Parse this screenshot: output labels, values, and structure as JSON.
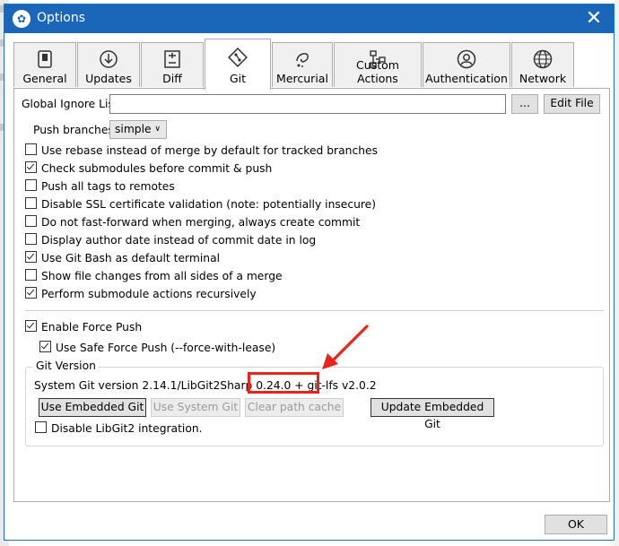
{
  "window": {
    "title": "Options",
    "close_symbol": "✕"
  },
  "tabs": [
    {
      "label": "General",
      "icon": "general-icon",
      "active": false
    },
    {
      "label": "Updates",
      "icon": "updates-icon",
      "active": false
    },
    {
      "label": "Diff",
      "icon": "diff-icon",
      "active": false
    },
    {
      "label": "Git",
      "icon": "git-icon",
      "active": true
    },
    {
      "label": "Mercurial",
      "icon": "mercurial-icon",
      "active": false
    },
    {
      "label": "Custom Actions",
      "icon": "custom-actions-icon",
      "active": false
    },
    {
      "label": "Authentication",
      "icon": "authentication-icon",
      "active": false
    },
    {
      "label": "Network",
      "icon": "network-icon",
      "active": false
    }
  ],
  "git": {
    "global_ignore_label": "Global Ignore List:",
    "global_ignore_value": "",
    "browse_label": "...",
    "edit_file_label": "Edit File",
    "push_branches_label": "Push branches:",
    "push_branches_value": "simple",
    "options": [
      {
        "label": "Use rebase instead of merge by default for tracked branches",
        "checked": false
      },
      {
        "label": "Check submodules before commit & push",
        "checked": true
      },
      {
        "label": "Push all tags to remotes",
        "checked": false
      },
      {
        "label": "Disable SSL certificate validation (note: potentially insecure)",
        "checked": false
      },
      {
        "label": "Do not fast-forward when merging, always create commit",
        "checked": false
      },
      {
        "label": "Display author date instead of commit date in log",
        "checked": false
      },
      {
        "label": "Use Git Bash as default terminal",
        "checked": true
      },
      {
        "label": "Show file changes from all sides of a merge",
        "checked": false
      },
      {
        "label": "Perform submodule actions recursively",
        "checked": true
      }
    ],
    "force_push": {
      "label": "Enable Force Push",
      "checked": true
    },
    "safe_force_push": {
      "label": "Use Safe Force Push (--force-with-lease)",
      "checked": true
    },
    "version_group": {
      "title": "Git Version",
      "version_text": "System Git version 2.14.1/LibGit2Sharp 0.24.0 + ",
      "git_lfs_text": "git-lfs v2.0.2",
      "use_embedded_label": "Use Embedded Git",
      "use_system_label": "Use System Git",
      "clear_path_label": "Clear path cache",
      "update_embedded_label": "Update Embedded Git",
      "disable_libgit2": {
        "label": "Disable LibGit2 integration.",
        "checked": false
      }
    }
  },
  "footer": {
    "ok_label": "OK"
  },
  "annotation": {
    "color": "#e8231a"
  }
}
